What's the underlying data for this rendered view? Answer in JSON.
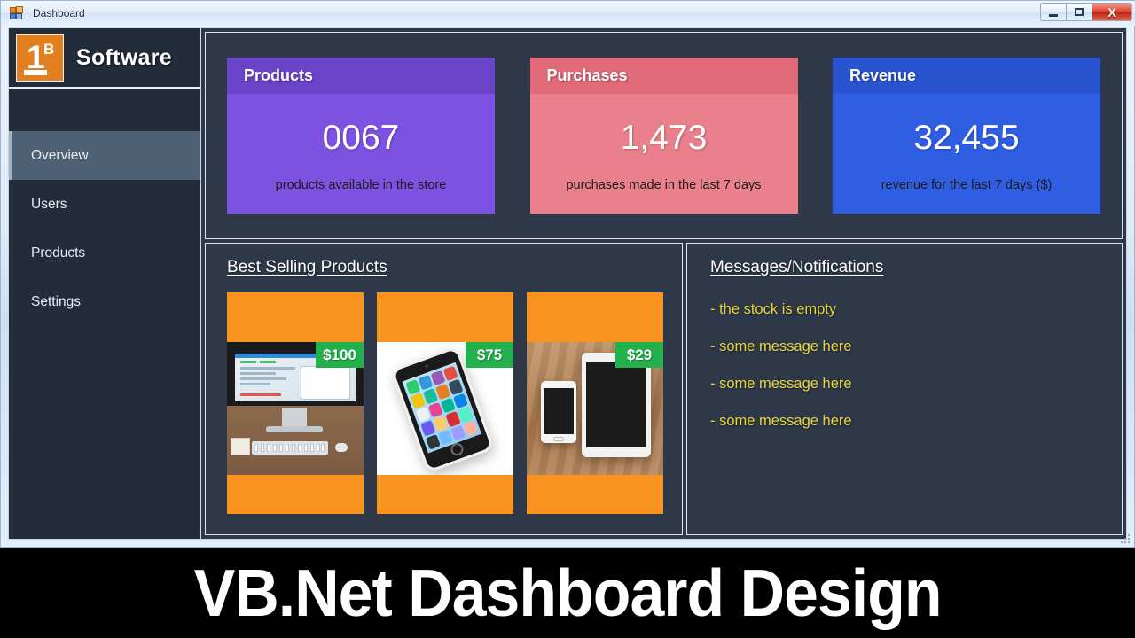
{
  "window": {
    "title": "Dashboard",
    "icon": "vb-form-icon",
    "buttons": {
      "minimize": "–",
      "maximize": "□",
      "close": "X"
    }
  },
  "sidebar": {
    "brand": {
      "logo_text_main": "1",
      "logo_text_sup": "B",
      "name": "Software"
    },
    "items": [
      {
        "label": "Overview",
        "active": true
      },
      {
        "label": "Users",
        "active": false
      },
      {
        "label": "Products",
        "active": false
      },
      {
        "label": "Settings",
        "active": false
      }
    ]
  },
  "stats": {
    "cards": [
      {
        "title": "Products",
        "value": "0067",
        "caption": "products available in the store",
        "head_color": "#6a44c8",
        "body_color": "#7d52e0"
      },
      {
        "title": "Purchases",
        "value": "1,473",
        "caption": "purchases made in the last 7 days",
        "head_color": "#e06a78",
        "body_color": "#ea808c"
      },
      {
        "title": "Revenue",
        "value": "32,455",
        "caption": "revenue for the last 7 days ($)",
        "head_color": "#2a54cf",
        "body_color": "#2f5ee3"
      }
    ]
  },
  "best_selling": {
    "title": "Best Selling Products",
    "tile_color": "#f7931e",
    "price_badge_color": "#22b14c",
    "products": [
      {
        "price": "$100",
        "image": "imac-desktop-photo"
      },
      {
        "price": "$75",
        "image": "iphone-photo"
      },
      {
        "price": "$29",
        "image": "phone-and-tablet-photo"
      }
    ]
  },
  "messages": {
    "title": "Messages/Notifications",
    "text_color": "#e8d53a",
    "items": [
      "- the stock is empty",
      "- some message here",
      "- some message here",
      "- some message here"
    ]
  },
  "banner": {
    "text": "VB.Net Dashboard Design"
  }
}
